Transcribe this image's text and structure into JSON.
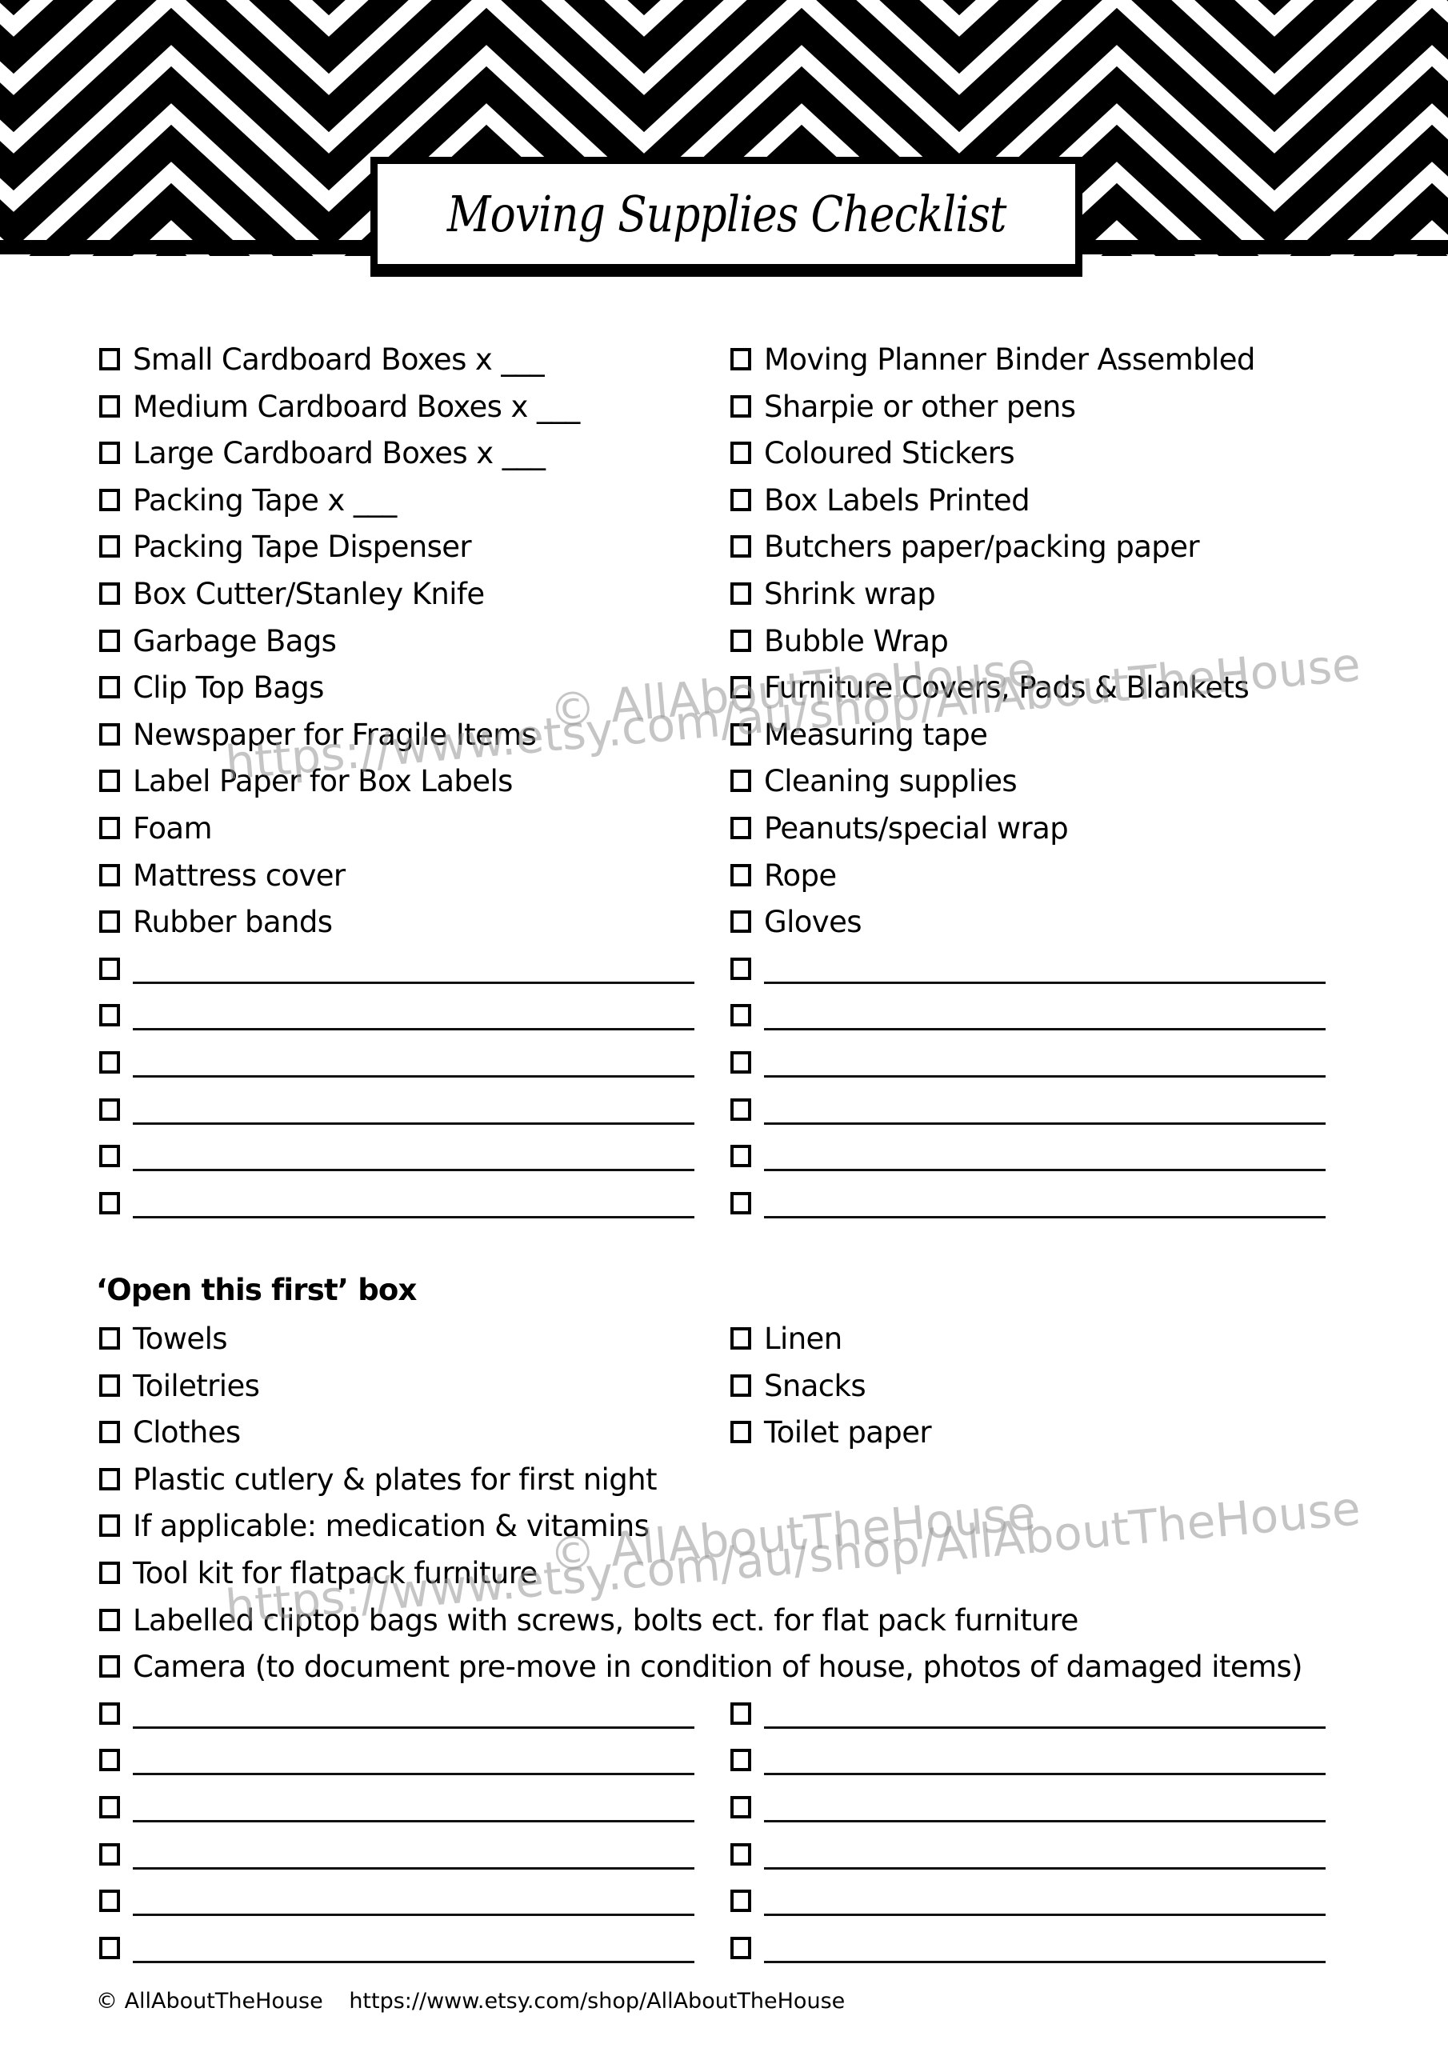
{
  "title": "Moving Supplies Checklist",
  "supplies": {
    "left": [
      "Small Cardboard Boxes x ___",
      "Medium Cardboard Boxes x ___",
      "Large Cardboard Boxes x ___",
      "Packing Tape x ___",
      "Packing Tape Dispenser",
      "Box Cutter/Stanley Knife",
      "Garbage Bags",
      "Clip Top Bags",
      "Newspaper for Fragile Items",
      "Label Paper for Box Labels",
      "Foam",
      "Mattress cover",
      "Rubber bands"
    ],
    "right": [
      "Moving Planner Binder Assembled",
      "Sharpie or other pens",
      "Coloured Stickers",
      "Box Labels Printed",
      "Butchers paper/packing paper",
      "Shrink wrap",
      "Bubble Wrap",
      "Furniture Covers, Pads & Blankets",
      "Measuring tape",
      "Cleaning supplies",
      "Peanuts/special wrap",
      "Rope",
      "Gloves"
    ],
    "blank_rows_per_column": 6
  },
  "open_first_box": {
    "heading": "‘Open this first’ box",
    "left": [
      "Towels",
      "Toiletries",
      "Clothes"
    ],
    "right": [
      "Linen",
      "Snacks",
      "Toilet paper"
    ],
    "full_width": [
      "Plastic cutlery & plates for first night",
      "If applicable: medication & vitamins",
      "Tool kit for flatpack furniture",
      "Labelled cliptop bags with screws, bolts ect. for flat pack furniture",
      "Camera (to document pre-move in condition of house, photos of damaged items)"
    ],
    "blank_rows_per_column": 6
  },
  "watermark": {
    "copyright": "© AllAboutTheHouse",
    "url": "https://www.etsy.com/au/shop/AllAboutTheHouse"
  },
  "footer": {
    "copyright": "© AllAboutTheHouse",
    "url": "https://www.etsy.com/shop/AllAboutTheHouse"
  },
  "colors": {
    "ink": "#000000",
    "paper": "#ffffff",
    "watermark": "#9a9a9a"
  }
}
